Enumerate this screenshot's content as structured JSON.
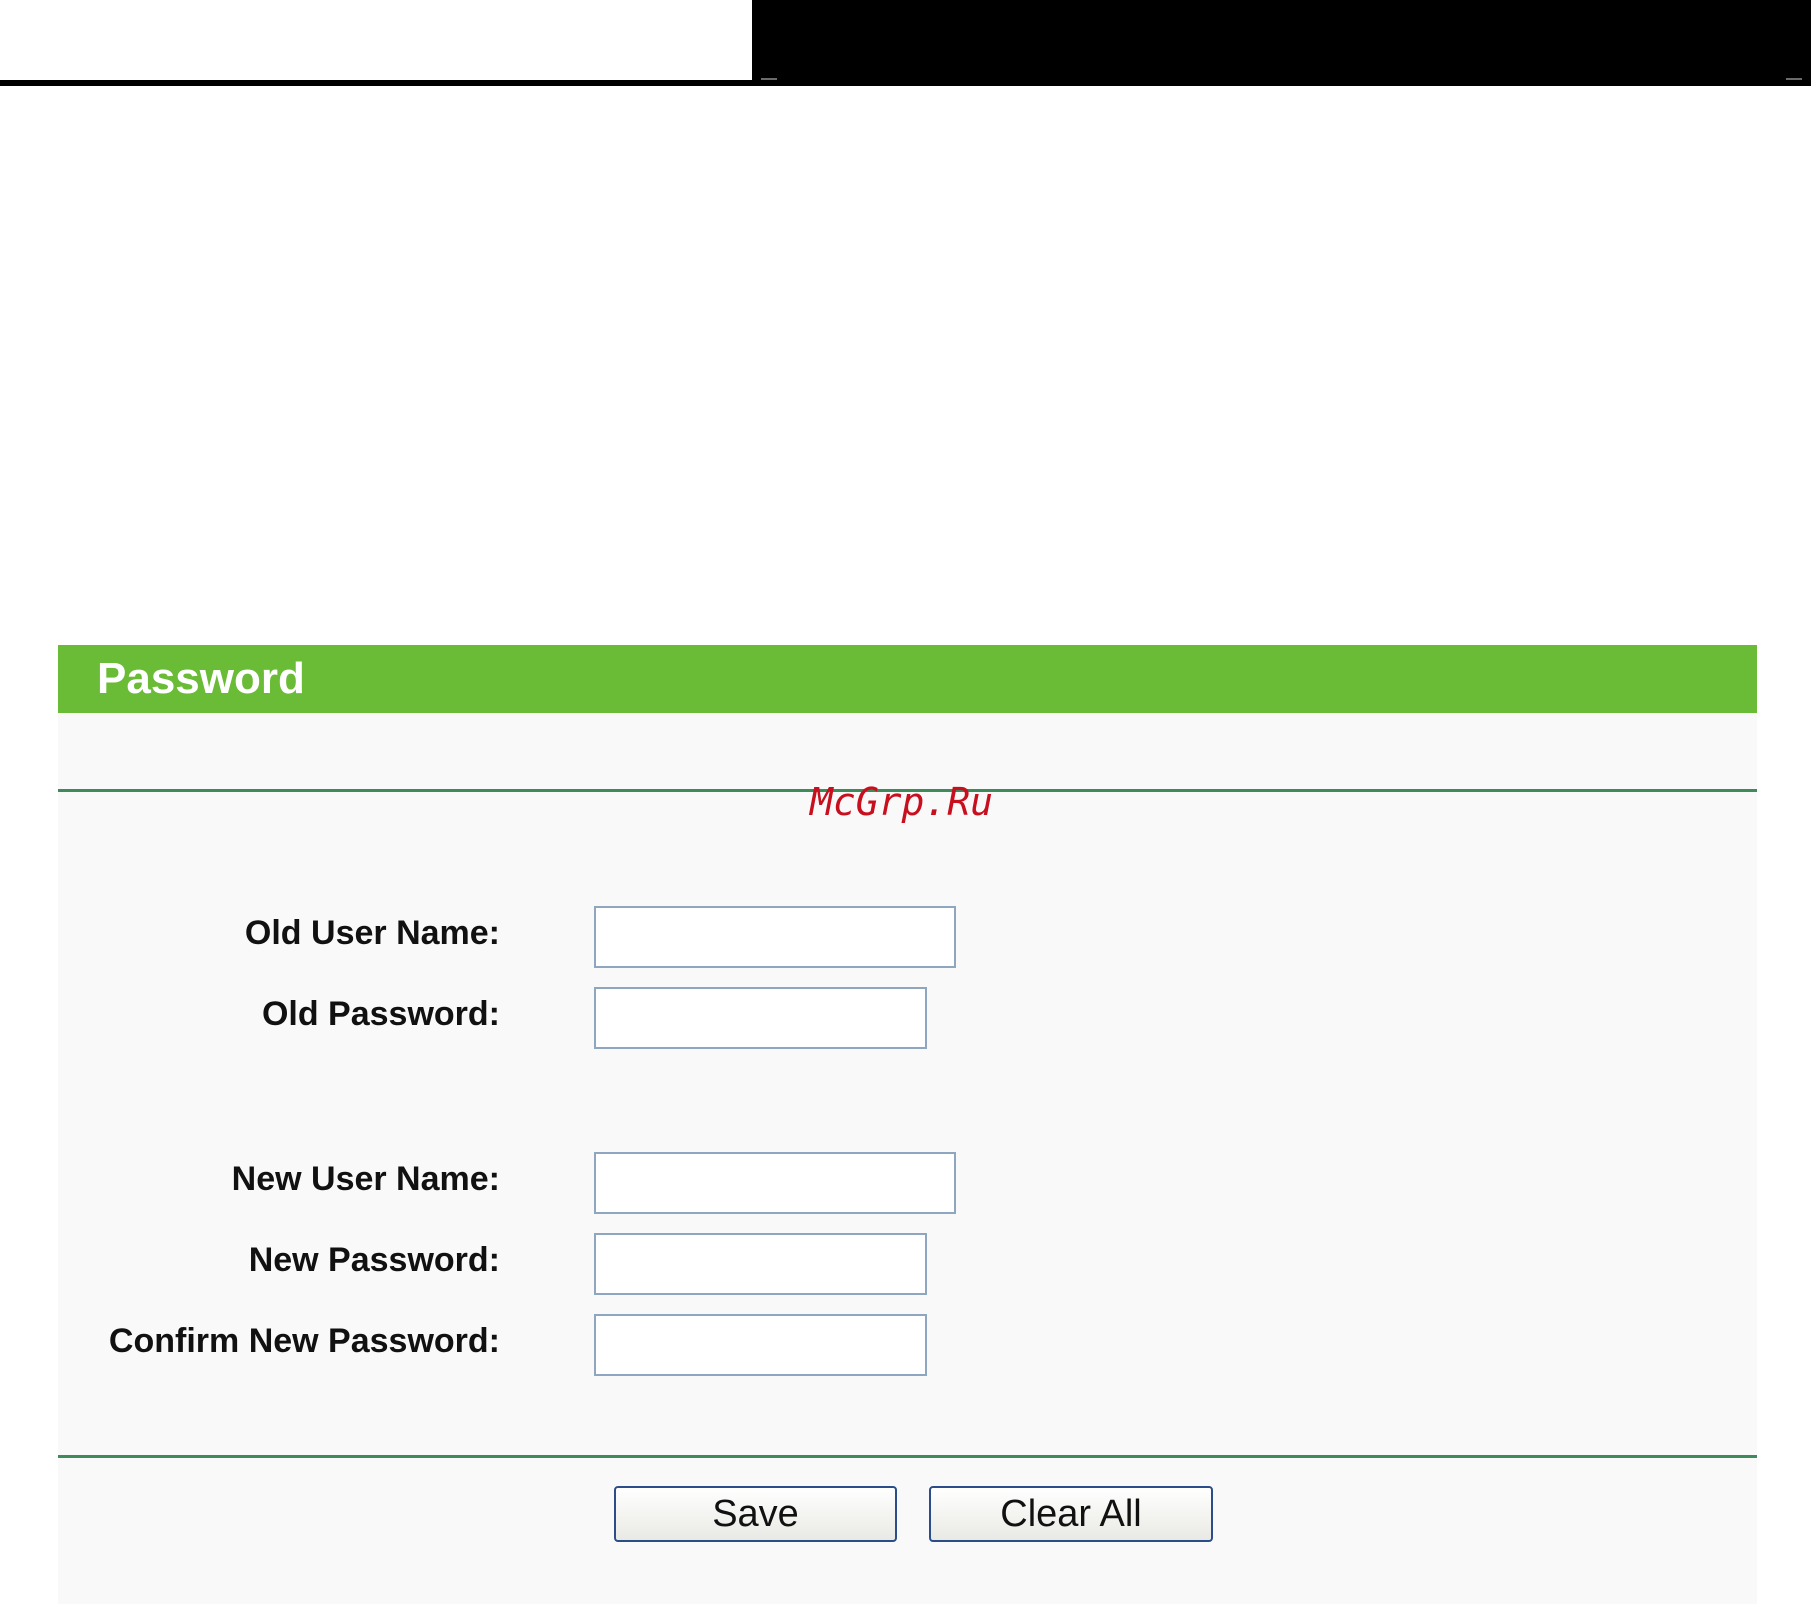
{
  "panel": {
    "title": "Password"
  },
  "form": {
    "fields": [
      {
        "label": "Old User Name:",
        "value": ""
      },
      {
        "label": "Old Password:",
        "value": ""
      },
      {
        "label": "New User Name:",
        "value": ""
      },
      {
        "label": "New Password:",
        "value": ""
      },
      {
        "label": "Confirm New Password:",
        "value": ""
      }
    ]
  },
  "buttons": {
    "save_label": "Save",
    "clear_label": "Clear All"
  },
  "watermark": {
    "text": "McGrp.Ru"
  },
  "colors": {
    "header_green": "#6abb35",
    "divider_green": "#3d8b5a",
    "input_border": "#8ea6c0",
    "button_border": "#2b4e8a",
    "watermark_red": "#c80f1e"
  }
}
